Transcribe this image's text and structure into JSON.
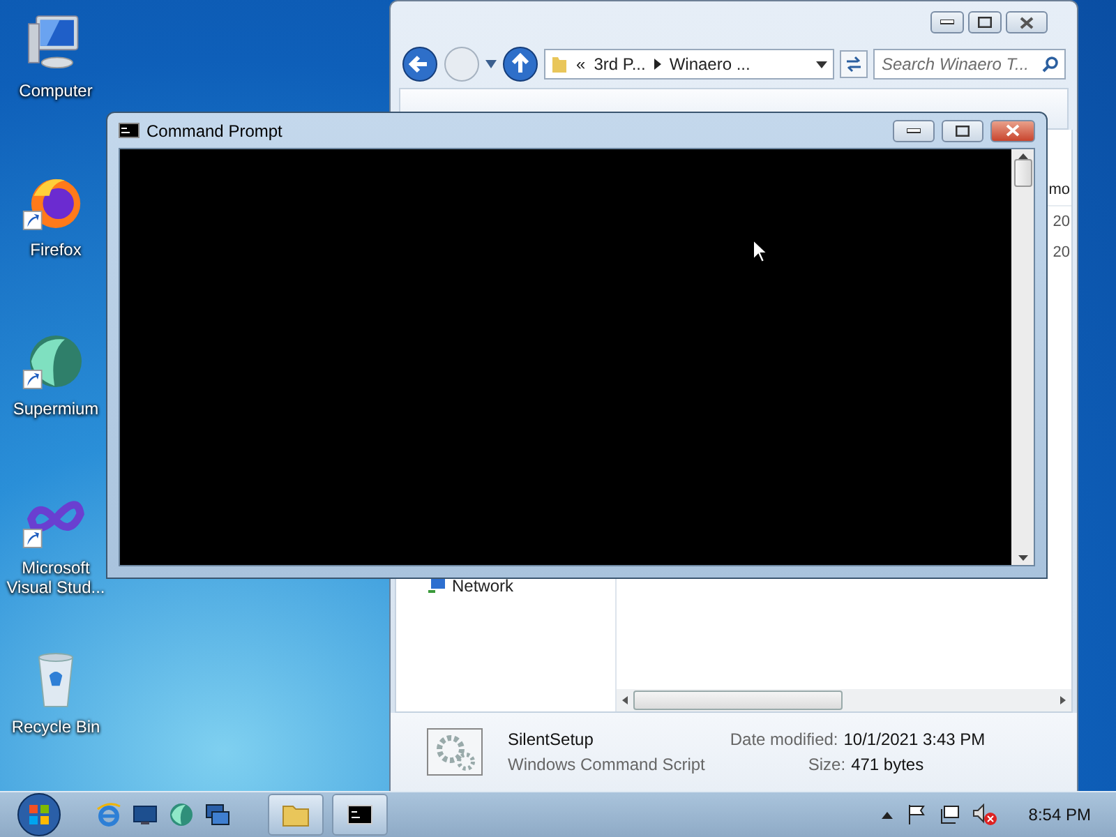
{
  "desktop_icons": [
    {
      "label": "Computer",
      "kind": "computer",
      "shortcut": false
    },
    {
      "label": "Firefox",
      "kind": "firefox",
      "shortcut": true
    },
    {
      "label": "Supermium",
      "kind": "supermium",
      "shortcut": true
    },
    {
      "label": "Microsoft Visual Stud...",
      "kind": "visualstudio",
      "shortcut": true
    },
    {
      "label": "Recycle Bin",
      "kind": "recycle",
      "shortcut": false
    }
  ],
  "explorer": {
    "address": [
      "«",
      "3rd P...",
      "Winaero ..."
    ],
    "search": {
      "placeholder": "Search Winaero T..."
    },
    "nav_items": [
      "Network"
    ],
    "column_3": "mo",
    "cells": [
      "20",
      "20"
    ],
    "details": {
      "name": "SilentSetup",
      "type": "Windows Command Script",
      "date_label": "Date modified:",
      "date": "10/1/2021 3:43 PM",
      "size_label": "Size:",
      "size": "471 bytes"
    }
  },
  "cmd": {
    "title": "Command Prompt"
  },
  "taskbar": {
    "quick_launch": [
      {
        "kind": "ie"
      },
      {
        "kind": "desktop"
      },
      {
        "kind": "supermium"
      },
      {
        "kind": "window"
      }
    ],
    "buttons": [
      {
        "kind": "explorer"
      },
      {
        "kind": "cmd"
      }
    ],
    "tray": [
      {
        "kind": "caret"
      },
      {
        "kind": "flag"
      },
      {
        "kind": "network"
      },
      {
        "kind": "sound"
      }
    ],
    "clock": "8:54 PM"
  }
}
